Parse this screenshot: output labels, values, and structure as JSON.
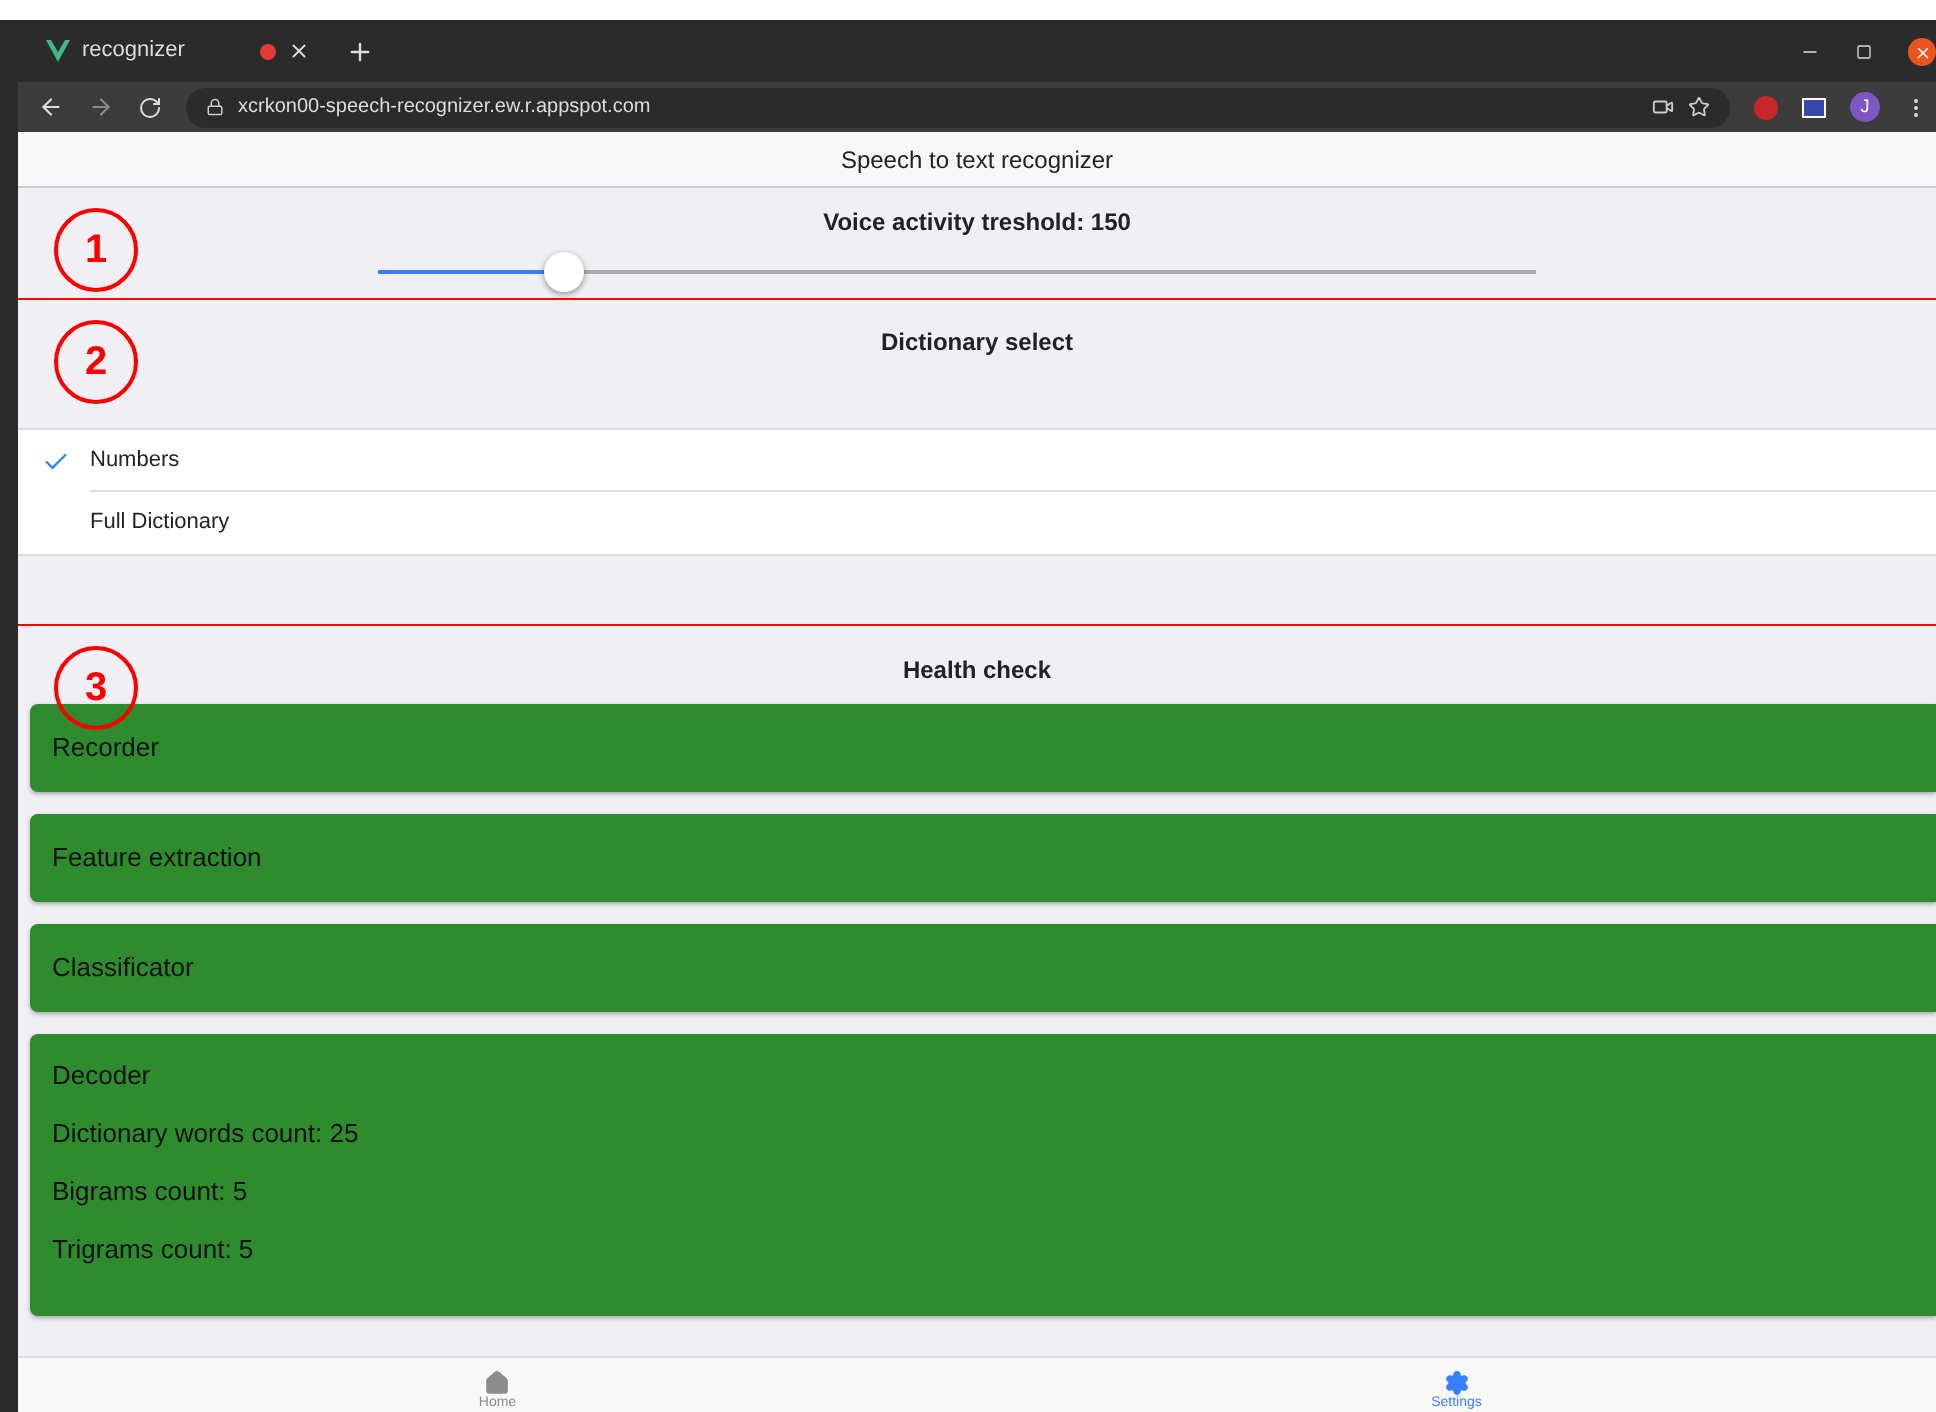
{
  "browser": {
    "tab": {
      "title": "recognizer",
      "recording": true
    },
    "url": "xcrkon00-speech-recognizer.ew.r.appspot.com",
    "profile": "J"
  },
  "header": {
    "title": "Speech to text recognizer"
  },
  "sections": [
    {
      "kind": "slider",
      "marker": "1",
      "title": "Voice activity treshold: 150",
      "level": 0.16
    },
    {
      "kind": "select",
      "marker": "2",
      "title": "Dictionary select",
      "options": [
        {
          "label": "Numbers",
          "selected": true
        },
        {
          "label": "Full Dictionary",
          "selected": false
        }
      ]
    },
    {
      "kind": "health",
      "marker": "3",
      "title": "Health check",
      "cards": [
        {
          "lines": [
            "Recorder"
          ]
        },
        {
          "lines": [
            "Feature extraction"
          ]
        },
        {
          "lines": [
            "Classificator"
          ]
        },
        {
          "lines": [
            "Decoder",
            "Dictionary words count: 25",
            "Bigrams count: 5",
            "Trigrams count: 5"
          ]
        }
      ]
    }
  ],
  "bottom_nav": [
    {
      "label": "Home",
      "selected": false
    },
    {
      "label": "Settings",
      "selected": true
    }
  ]
}
